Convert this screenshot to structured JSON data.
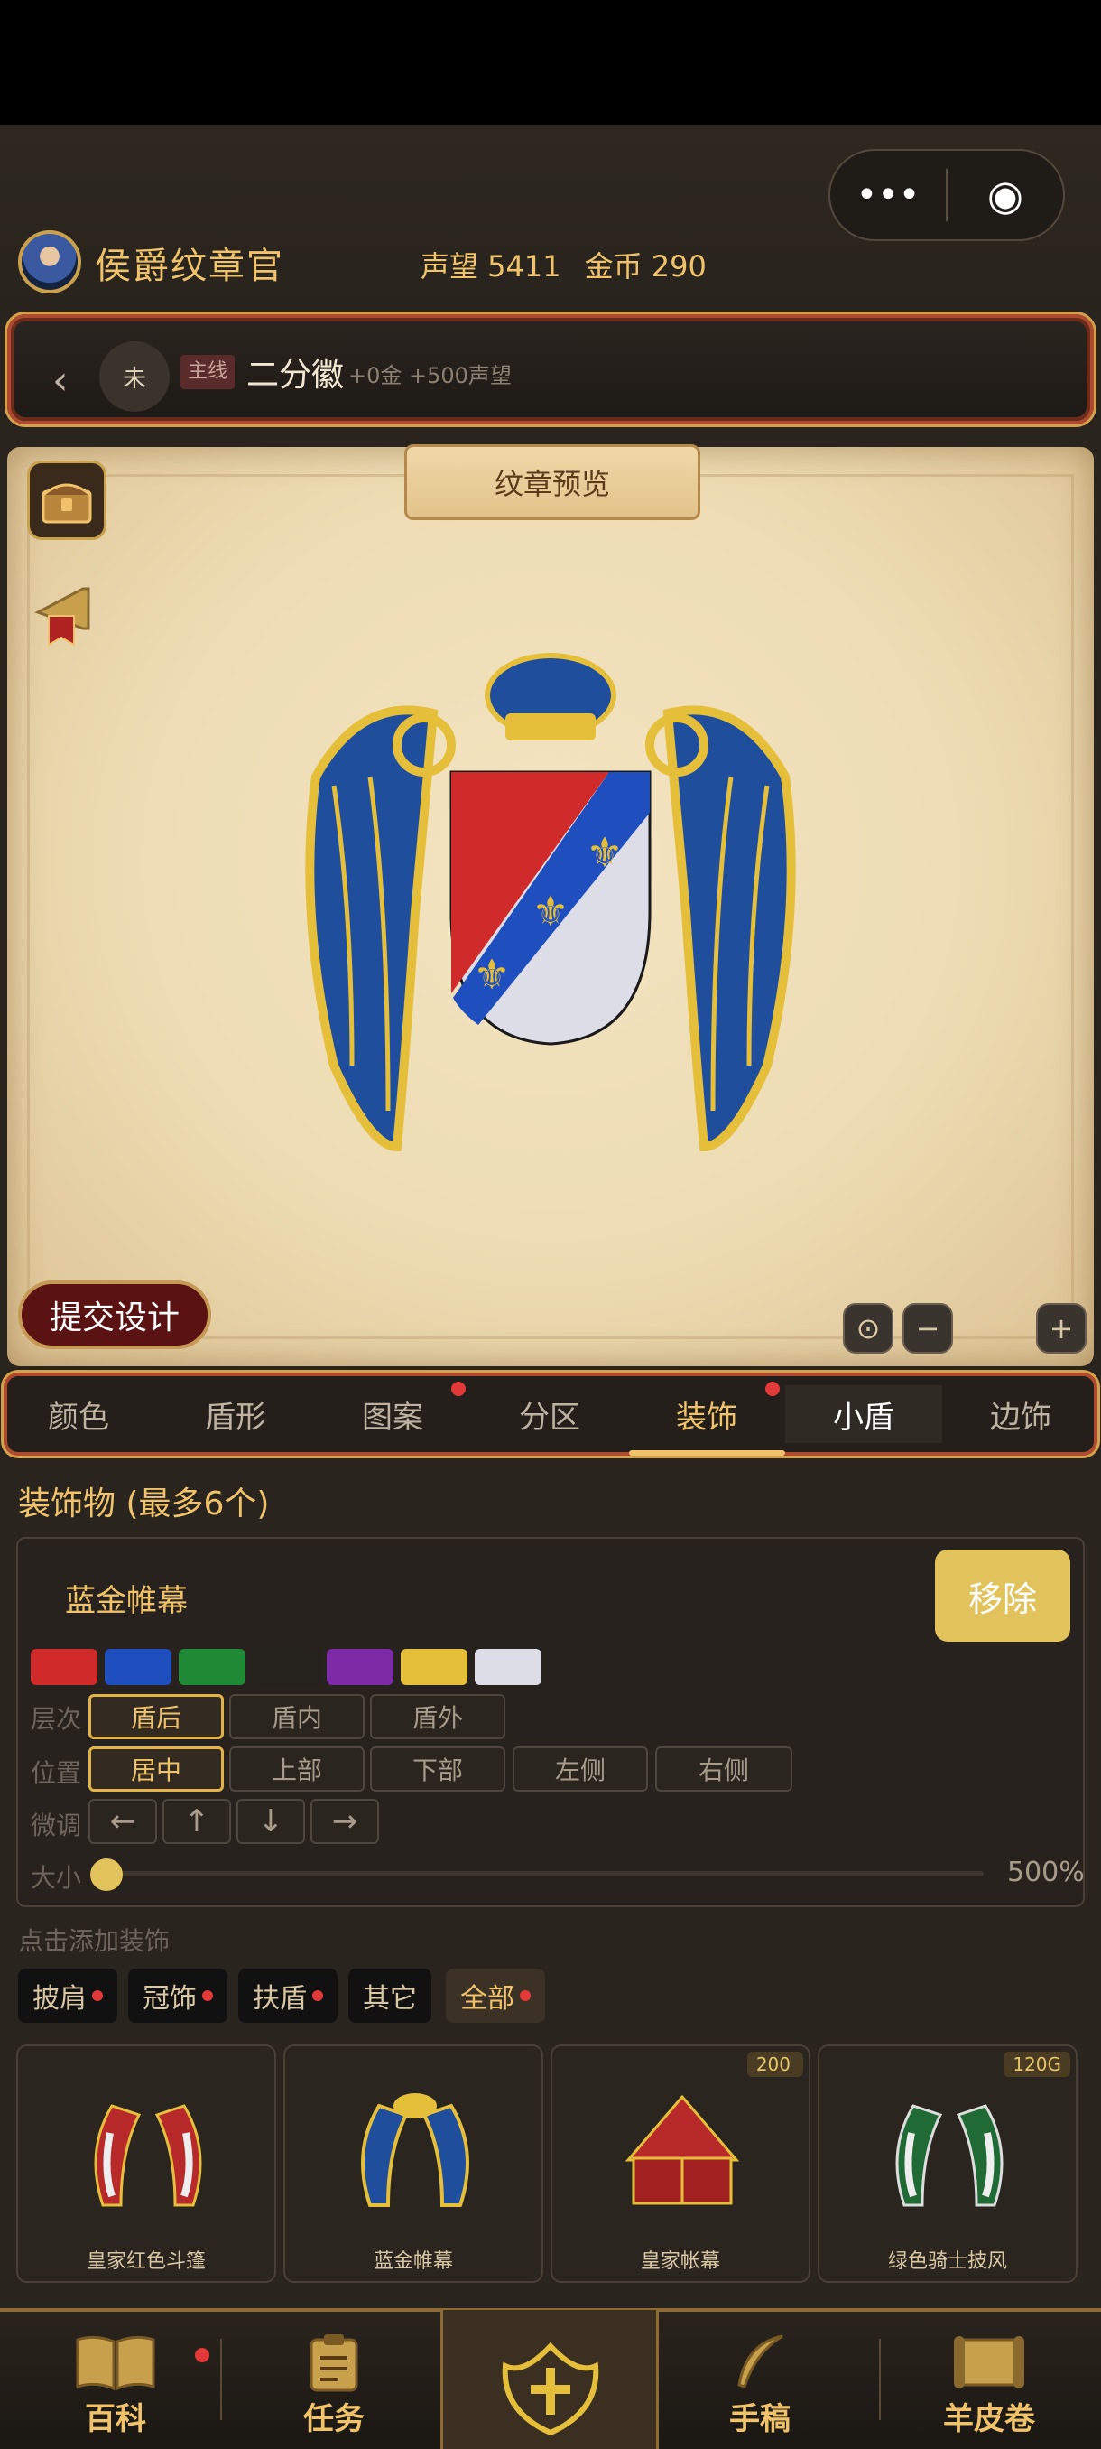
{
  "header": {
    "title": "侯爵纹章官",
    "reputation": "声望 5411",
    "gold": "金币 290",
    "capsule_more": "•••",
    "capsule_close": "◉"
  },
  "quest": {
    "back": "‹",
    "status": "未",
    "tag": "主线",
    "name": "二分徽",
    "reward": "+0金 +500声望"
  },
  "preview": {
    "title": "纹章预览",
    "submit_label": "提交设计",
    "controls": [
      "⊙",
      "−",
      "+"
    ]
  },
  "tabs": [
    {
      "label": "颜色"
    },
    {
      "label": "盾形"
    },
    {
      "label": "图案"
    },
    {
      "label": "分区"
    },
    {
      "label": "装饰"
    },
    {
      "label": "小盾"
    },
    {
      "label": "边饰"
    }
  ],
  "ornament": {
    "section_title": "装饰物 (最多6个)",
    "selected_name": "蓝金帷幕",
    "remove_label": "移除",
    "colors": [
      "#d12a2a",
      "#1f4fbf",
      "#1f8a35",
      "#25211d",
      "#7d2aa6",
      "#e6bf3a",
      "#dcdde6"
    ],
    "layer_label": "层次",
    "layer_options": [
      "盾后",
      "盾内",
      "盾外"
    ],
    "layer_selected": "盾后",
    "position_label": "位置",
    "position_options": [
      "居中",
      "上部",
      "下部",
      "左侧",
      "右侧"
    ],
    "position_selected": "居中",
    "nudge_label": "微调",
    "nudge_options": [
      "←",
      "↑",
      "↓",
      "→"
    ],
    "size_label": "大小",
    "size_value": "500%"
  },
  "add": {
    "hint": "点击添加装饰",
    "filters": [
      "披肩",
      "冠饰",
      "扶盾",
      "其它",
      "全部"
    ],
    "filter_selected": "全部",
    "items": [
      {
        "name": "皇家红色斗篷",
        "price": ""
      },
      {
        "name": "蓝金帷幕",
        "price": ""
      },
      {
        "name": "皇家帐幕",
        "price": "200"
      },
      {
        "name": "绿色骑士披风",
        "price": "120G"
      }
    ]
  },
  "nav": [
    {
      "label": "百科"
    },
    {
      "label": "任务"
    },
    {
      "label": ""
    },
    {
      "label": "手稿"
    },
    {
      "label": "羊皮卷"
    }
  ]
}
